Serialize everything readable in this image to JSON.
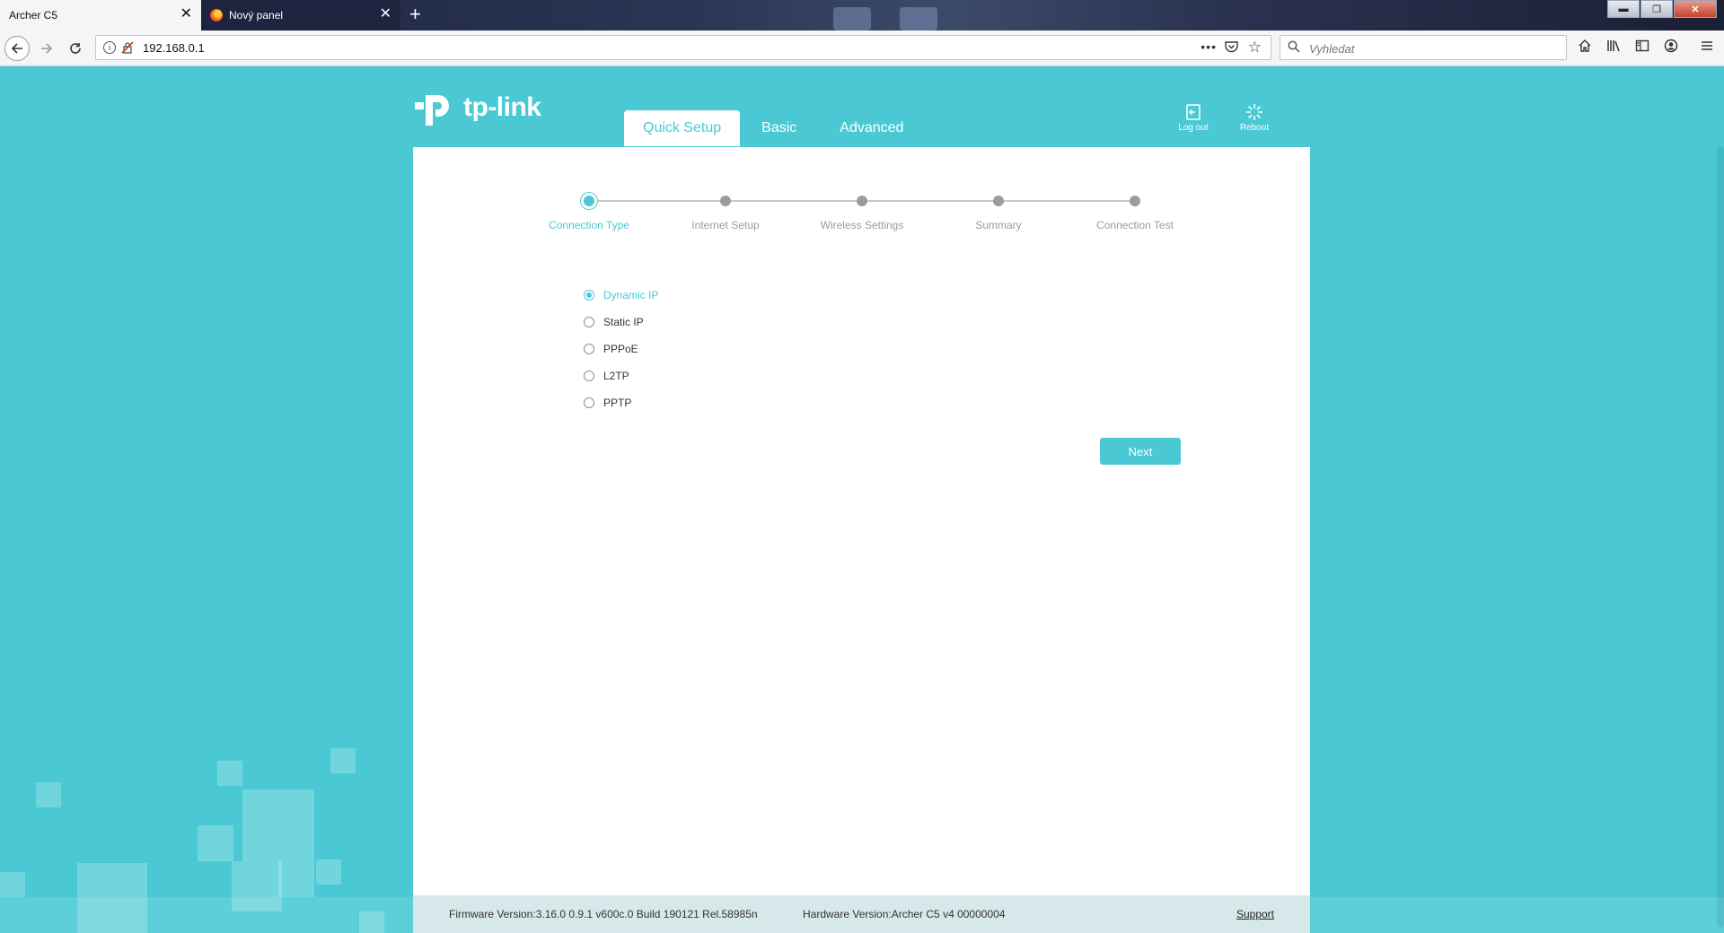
{
  "browser": {
    "tabs": [
      {
        "title": "Archer C5",
        "active": true
      },
      {
        "title": "Nový panel",
        "active": false
      }
    ],
    "new_tab_icon": "+",
    "window_controls": {
      "minimize": "▬",
      "restore": "❐",
      "close": "✕"
    },
    "url": "192.168.0.1",
    "search_placeholder": "Vyhledat",
    "more_icon": "•••"
  },
  "router": {
    "brand": "tp-link",
    "nav_tabs": [
      {
        "label": "Quick Setup",
        "active": true
      },
      {
        "label": "Basic",
        "active": false
      },
      {
        "label": "Advanced",
        "active": false
      }
    ],
    "header_actions": {
      "logout": "Log out",
      "reboot": "Reboot"
    },
    "steps": [
      {
        "label": "Connection Type",
        "active": true
      },
      {
        "label": "Internet Setup",
        "active": false
      },
      {
        "label": "Wireless Settings",
        "active": false
      },
      {
        "label": "Summary",
        "active": false
      },
      {
        "label": "Connection Test",
        "active": false
      }
    ],
    "connection_types": [
      {
        "label": "Dynamic IP",
        "checked": true
      },
      {
        "label": "Static IP",
        "checked": false
      },
      {
        "label": "PPPoE",
        "checked": false
      },
      {
        "label": "L2TP",
        "checked": false
      },
      {
        "label": "PPTP",
        "checked": false
      }
    ],
    "next_label": "Next",
    "footer": {
      "firmware": "Firmware Version:3.16.0 0.9.1 v600c.0 Build 190121 Rel.58985n",
      "hardware": "Hardware Version:Archer C5 v4 00000004",
      "support": "Support"
    }
  },
  "colors": {
    "accent": "#4ac9d5",
    "footer_bg": "#d7e8ea",
    "inactive_step": "#9c9c9c"
  }
}
